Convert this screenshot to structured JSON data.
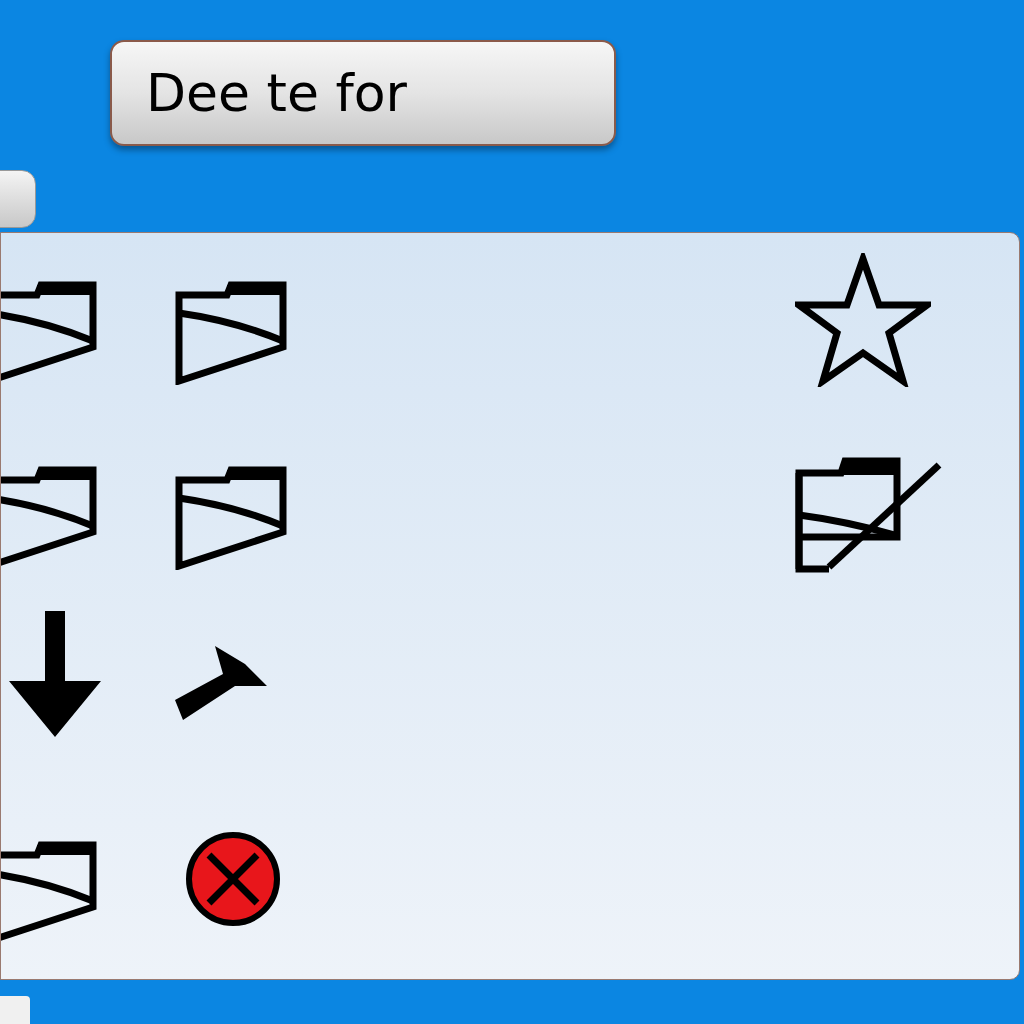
{
  "header_button": {
    "label": "Dee te for"
  },
  "left_icons": [
    {
      "kind": "folder"
    },
    {
      "kind": "folder"
    },
    {
      "kind": "folder"
    },
    {
      "kind": "folder"
    },
    {
      "kind": "arrow-down"
    },
    {
      "kind": "tool"
    },
    {
      "kind": "folder"
    },
    {
      "kind": "delete"
    }
  ],
  "right_icons": [
    {
      "kind": "star"
    },
    {
      "kind": "folder-slash"
    }
  ]
}
